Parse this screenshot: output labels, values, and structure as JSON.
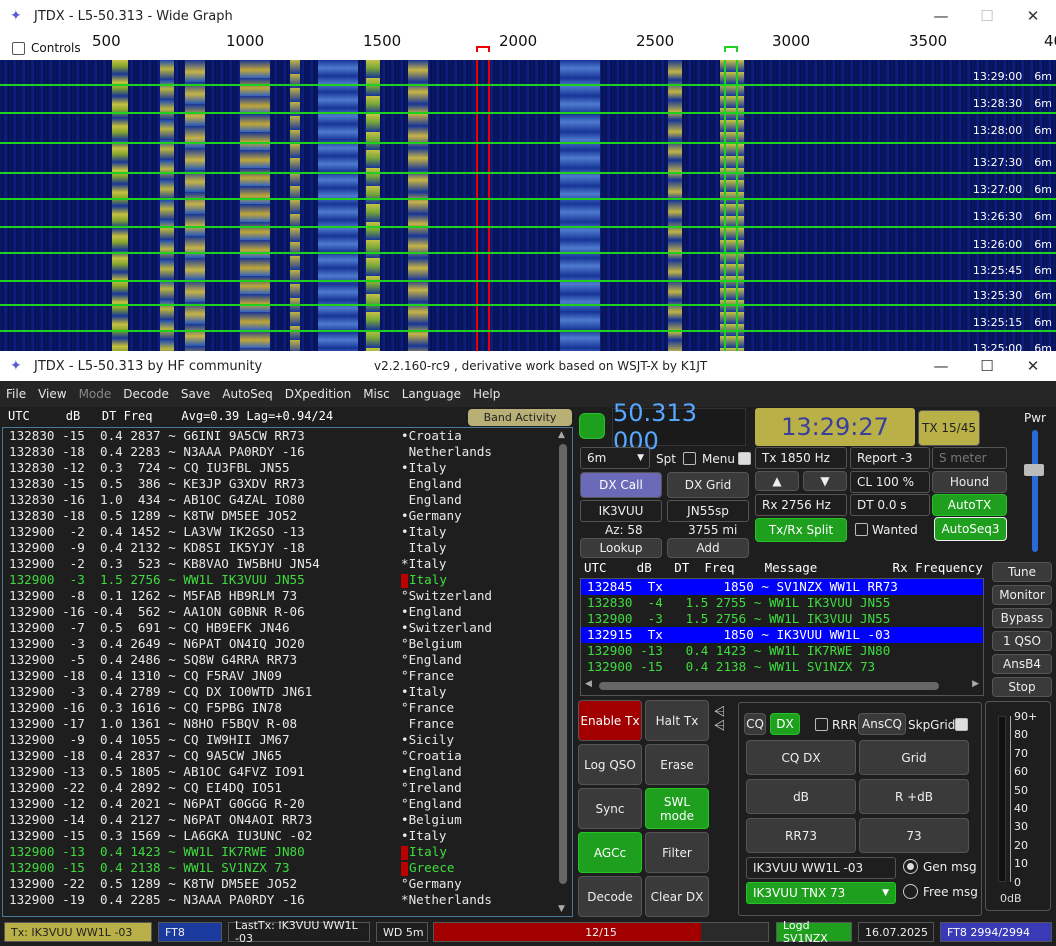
{
  "wide_graph": {
    "title": "JTDX - L5-50.313 - Wide Graph",
    "controls_label": "Controls",
    "scale_ticks": [
      "500",
      "1000",
      "1500",
      "2000",
      "2500",
      "3000",
      "3500",
      "40"
    ],
    "time_labels": [
      {
        "time": "13:29:00",
        "band": "6m"
      },
      {
        "time": "13:28:30",
        "band": "6m"
      },
      {
        "time": "13:28:00",
        "band": "6m"
      },
      {
        "time": "13:27:30",
        "band": "6m"
      },
      {
        "time": "13:27:00",
        "band": "6m"
      },
      {
        "time": "13:26:30",
        "band": "6m"
      },
      {
        "time": "13:26:00",
        "band": "6m"
      },
      {
        "time": "13:25:45",
        "band": "6m"
      },
      {
        "time": "13:25:30",
        "band": "6m"
      },
      {
        "time": "13:25:15",
        "band": "6m"
      },
      {
        "time": "13:25:00",
        "band": "6m"
      }
    ]
  },
  "main": {
    "title_left": "JTDX - L5-50.313  by HF community",
    "title_center": "v2.2.160-rc9 , derivative work based on WSJT-X by K1JT",
    "menu": [
      "File",
      "View",
      "Mode",
      "Decode",
      "Save",
      "AutoSeq",
      "DXpedition",
      "Misc",
      "Language",
      "Help"
    ],
    "menu_disabled": "Mode",
    "band_activity_header": "UTC     dB   DT Freq    Avg=0.39 Lag=+0.94/24",
    "band_activity_button": "Band Activity",
    "decodes": [
      {
        "text": "132830 -15  0.4 2837 ~ G6INI 9A5CW RR73",
        "country": "•Croatia",
        "green": false,
        "mark": false
      },
      {
        "text": "132830 -18  0.4 2283 ~ N3AAA PA0RDY -16",
        "country": " Netherlands",
        "green": false,
        "mark": false
      },
      {
        "text": "132830 -12  0.3  724 ~ CQ IU3FBL JN55",
        "country": "•Italy",
        "green": false,
        "mark": false
      },
      {
        "text": "132830 -15  0.5  386 ~ KE3JP G3XDV RR73",
        "country": " England",
        "green": false,
        "mark": false
      },
      {
        "text": "132830 -16  1.0  434 ~ AB1OC G4ZAL IO80",
        "country": " England",
        "green": false,
        "mark": false
      },
      {
        "text": "132830 -18  0.5 1289 ~ K8TW DM5EE JO52",
        "country": "•Germany",
        "green": false,
        "mark": false
      },
      {
        "text": "132900  -2  0.4 1452 ~ LA3VW IK2GSO -13",
        "country": "•Italy",
        "green": false,
        "mark": false
      },
      {
        "text": "132900  -9  0.4 2132 ~ KD8SI IK5YJY -18",
        "country": " Italy",
        "green": false,
        "mark": false
      },
      {
        "text": "132900  -2  0.3  523 ~ KB8VAO IW5BHU JN54",
        "country": "*Italy",
        "green": false,
        "mark": false
      },
      {
        "text": "132900  -3  1.5 2756 ~ WW1L IK3VUU JN55",
        "country": "Italy",
        "green": true,
        "mark": true
      },
      {
        "text": "132900  -8  0.1 1262 ~ M5FAB HB9RLM 73",
        "country": "°Switzerland",
        "green": false,
        "mark": false
      },
      {
        "text": "132900 -16 -0.4  562 ~ AA1ON G0BNR R-06",
        "country": "•England",
        "green": false,
        "mark": false
      },
      {
        "text": "132900  -7  0.5  691 ~ CQ HB9EFK JN46",
        "country": "•Switzerland",
        "green": false,
        "mark": false
      },
      {
        "text": "132900  -3  0.4 2649 ~ N6PAT ON4IQ JO20",
        "country": "°Belgium",
        "green": false,
        "mark": false
      },
      {
        "text": "132900  -5  0.4 2486 ~ SQ8W G4RRA RR73",
        "country": "°England",
        "green": false,
        "mark": false
      },
      {
        "text": "132900 -18  0.4 1310 ~ CQ F5RAV JN09",
        "country": "°France",
        "green": false,
        "mark": false
      },
      {
        "text": "132900  -3  0.4 2789 ~ CQ DX IO0WTD JN61",
        "country": "•Italy",
        "green": false,
        "mark": false
      },
      {
        "text": "132900 -16  0.3 1616 ~ CQ F5PBG IN78",
        "country": "°France",
        "green": false,
        "mark": false
      },
      {
        "text": "132900 -17  1.0 1361 ~ N8HO F5BQV R-08",
        "country": " France",
        "green": false,
        "mark": false
      },
      {
        "text": "132900  -9  0.4 1055 ~ CQ IW9HII JM67",
        "country": "•Sicily",
        "green": false,
        "mark": false
      },
      {
        "text": "132900 -18  0.4 2837 ~ CQ 9A5CW JN65",
        "country": "°Croatia",
        "green": false,
        "mark": false
      },
      {
        "text": "132900 -13  0.5 1805 ~ AB1OC G4FVZ IO91",
        "country": "•England",
        "green": false,
        "mark": false
      },
      {
        "text": "132900 -22  0.4 2892 ~ CQ EI4DQ IO51",
        "country": "°Ireland",
        "green": false,
        "mark": false
      },
      {
        "text": "132900 -12  0.4 2021 ~ N6PAT G0GGG R-20",
        "country": "°England",
        "green": false,
        "mark": false
      },
      {
        "text": "132900 -14  0.4 2127 ~ N6PAT ON4AOI RR73",
        "country": "•Belgium",
        "green": false,
        "mark": false
      },
      {
        "text": "132900 -15  0.3 1569 ~ LA6GKA IU3UNC -02",
        "country": "•Italy",
        "green": false,
        "mark": false
      },
      {
        "text": "132900 -13  0.4 1423 ~ WW1L IK7RWE JN80",
        "country": "Italy",
        "green": true,
        "mark": true
      },
      {
        "text": "132900 -15  0.4 2138 ~ WW1L SV1NZX 73",
        "country": "Greece",
        "green": true,
        "mark": true
      },
      {
        "text": "132900 -22  0.5 1289 ~ K8TW DM5EE JO52",
        "country": "°Germany",
        "green": false,
        "mark": false
      },
      {
        "text": "132900 -19  0.4 2285 ~ N3AAA PA0RDY -16",
        "country": "*Netherlands",
        "green": false,
        "mark": false
      }
    ],
    "frequency": "50.313 000",
    "clock": "13:29:27",
    "tx_period": "TX 15/45",
    "pwr_label": "Pwr",
    "band": "6m",
    "spt_label": "Spt",
    "menu_label": "Menu",
    "dx_call_btn": "DX Call",
    "dx_grid_btn": "DX Grid",
    "dx_call": "IK3VUU",
    "dx_grid": "JN55sp",
    "az": "Az: 58",
    "dist": "3755 mi",
    "lookup_btn": "Lookup",
    "add_btn": "Add",
    "tx_freq": "Tx  1850  Hz",
    "rx_freq": "Rx  2756  Hz",
    "report": "Report -3",
    "smeter_placeholder": "S meter",
    "cl": "CL  100 %",
    "dt": "DT 0.0 s",
    "hound_btn": "Hound",
    "autotx_btn": "AutoTX",
    "split_btn": "Tx/Rx Split",
    "wanted_label": "Wanted",
    "autoseq_btn": "AutoSeq3",
    "msg_header": "UTC    dB   DT  Freq    Message          Rx Frequency",
    "rx_messages": [
      {
        "text": "132845  Tx        1850 ~ SV1NZX WW1L RR73",
        "tx": true
      },
      {
        "text": "132830  -4   1.5 2755 ~ WW1L IK3VUU JN55",
        "tx": false
      },
      {
        "text": "132900  -3   1.5 2756 ~ WW1L IK3VUU JN55",
        "tx": false
      },
      {
        "text": "132915  Tx        1850 ~ IK3VUU WW1L -03",
        "tx": true
      },
      {
        "text": "132900 -13   0.4 1423 ~ WW1L IK7RWE JN80",
        "tx": false
      },
      {
        "text": "132900 -15   0.4 2138 ~ WW1L SV1NZX 73",
        "tx": false
      }
    ],
    "side_buttons": [
      "Tune",
      "Monitor",
      "Bypass",
      "1 QSO",
      "AnsB4",
      "Stop"
    ],
    "enable_tx": "Enable Tx",
    "halt_tx": "Halt Tx",
    "log_qso": "Log QSO",
    "erase": "Erase",
    "sync": "Sync",
    "swl_mode": "SWL mode",
    "agcc": "AGCc",
    "filter": "Filter",
    "decode": "Decode",
    "clear_dx": "Clear DX",
    "cq_btn": "CQ",
    "dx_btn": "DX",
    "rrr_label": "RRR",
    "anscq_btn": "AnsCQ",
    "skpgrid_label": "SkpGrid",
    "macro_buttons": [
      "CQ DX",
      "Grid",
      "dB",
      "R +dB",
      "RR73",
      "73"
    ],
    "gen_msg_value": "IK3VUU WW1L -03",
    "free_msg_value": "IK3VUU TNX 73",
    "gen_msg_label": "Gen msg",
    "free_msg_label": "Free msg",
    "meter_scale": [
      "90+",
      "80",
      "70",
      "60",
      "50",
      "40",
      "30",
      "20",
      "10",
      "0"
    ],
    "meter_value": "0dB",
    "status": {
      "tx": "Tx: IK3VUU WW1L -03",
      "mode": "FT8",
      "last_tx": "LastTx: IK3VUU WW1L -03",
      "wd": "WD 5m",
      "progress": "12/15",
      "progress_fraction": 0.8,
      "logged": "Logd SV1NZX",
      "date": "16.07.2025",
      "counter": "FT8  2994/2994"
    }
  }
}
